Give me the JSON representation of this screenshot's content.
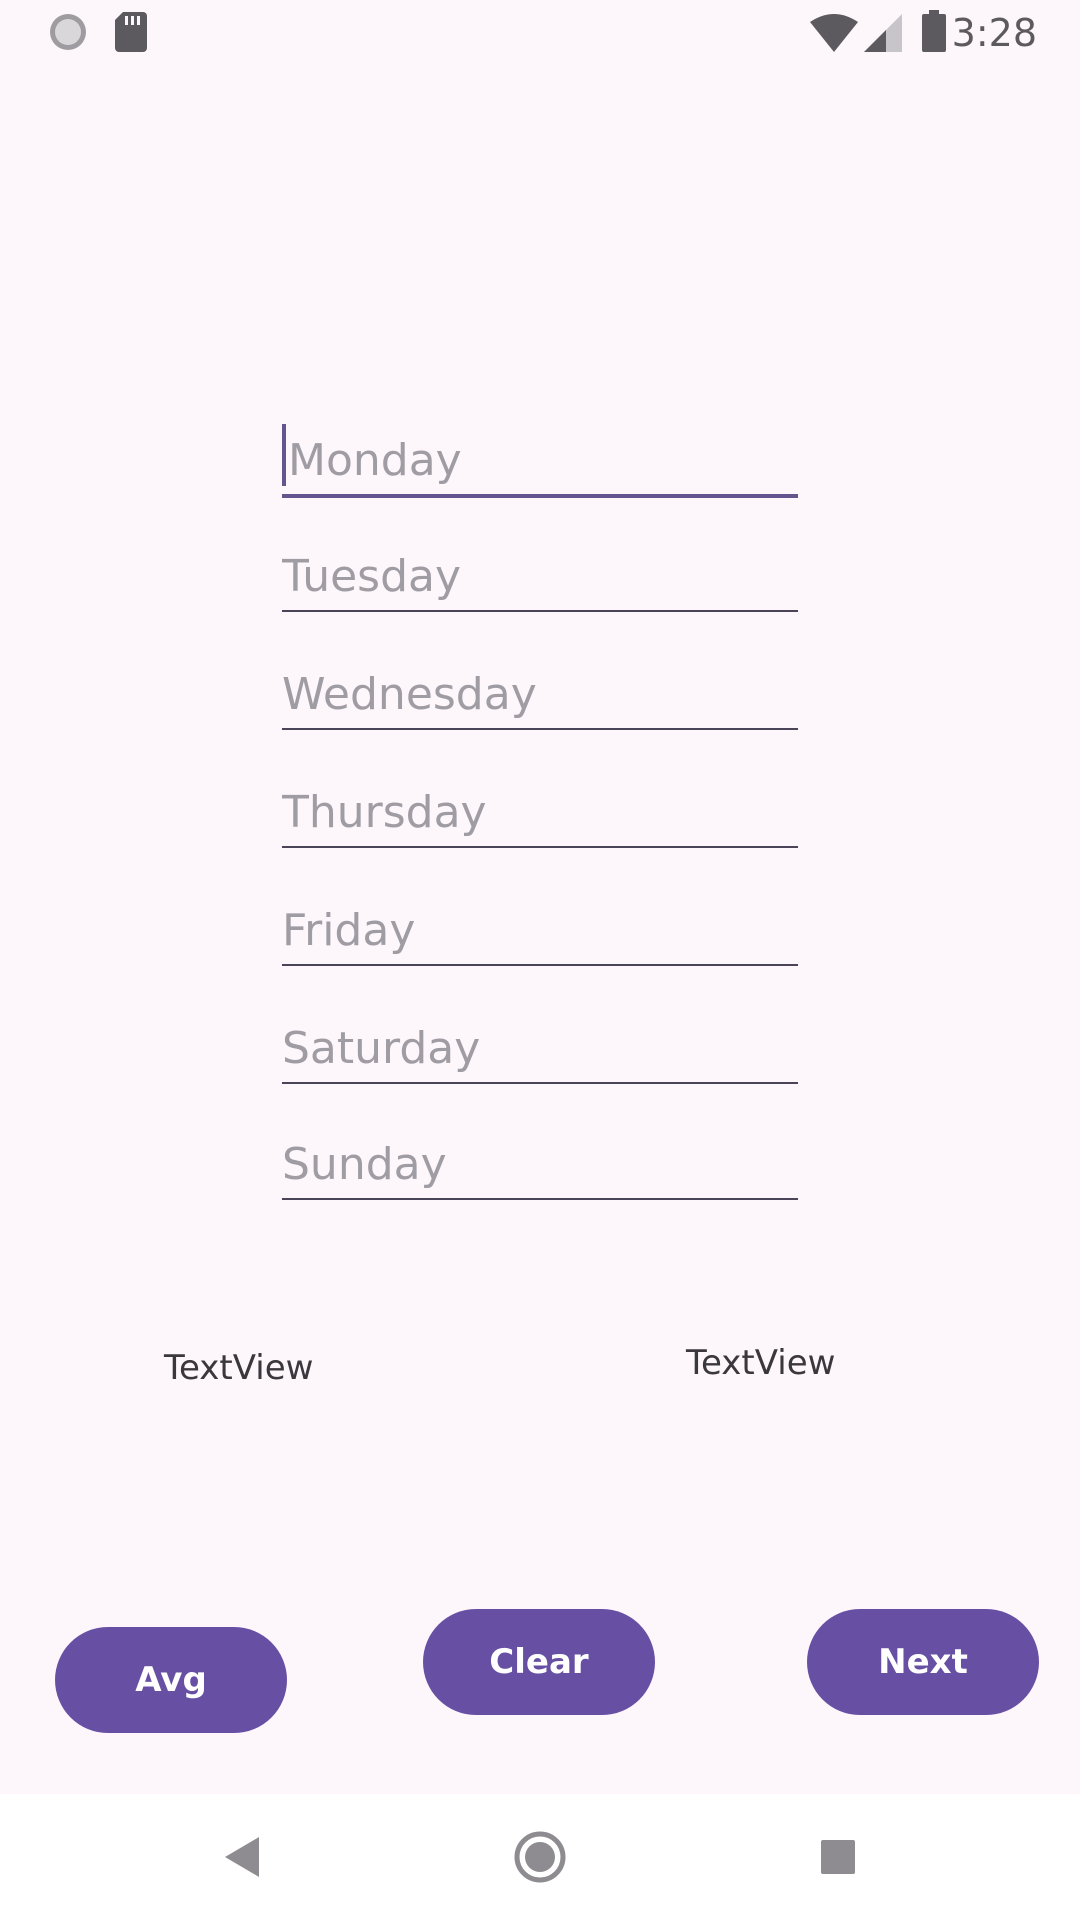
{
  "status_bar": {
    "time": "3:28",
    "icons": [
      "sync-icon",
      "sd-card-icon",
      "wifi-icon",
      "signal-icon",
      "battery-icon"
    ]
  },
  "form": {
    "fields": [
      {
        "placeholder": "Monday",
        "value": ""
      },
      {
        "placeholder": "Tuesday",
        "value": ""
      },
      {
        "placeholder": "Wednesday",
        "value": ""
      },
      {
        "placeholder": "Thursday",
        "value": ""
      },
      {
        "placeholder": "Friday",
        "value": ""
      },
      {
        "placeholder": "Saturday",
        "value": ""
      },
      {
        "placeholder": "Sunday",
        "value": ""
      }
    ]
  },
  "outputs": {
    "left_text": "TextView",
    "right_text": "TextView"
  },
  "buttons": {
    "avg": "Avg",
    "clear": "Clear",
    "next": "Next"
  },
  "navigation": {
    "icons": [
      "back-icon",
      "home-icon",
      "recents-icon"
    ]
  },
  "colors": {
    "background": "#fdf7fc",
    "accent": "#6750a4",
    "placeholder": "#a09ca3"
  }
}
